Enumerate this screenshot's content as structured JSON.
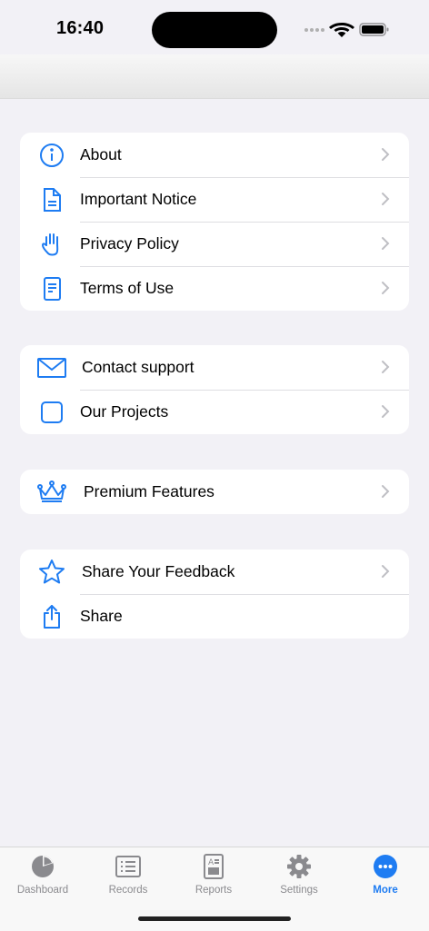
{
  "status": {
    "time": "16:40"
  },
  "accent": "#1e7cf2",
  "groups": [
    {
      "items": [
        {
          "label": "About",
          "icon": "info-icon",
          "chevron": true
        },
        {
          "label": "Important Notice",
          "icon": "document-icon",
          "chevron": true
        },
        {
          "label": "Privacy Policy",
          "icon": "hand-icon",
          "chevron": true
        },
        {
          "label": "Terms of Use",
          "icon": "doc-text-icon",
          "chevron": true
        }
      ]
    },
    {
      "items": [
        {
          "label": "Contact support",
          "icon": "envelope-icon",
          "chevron": true
        },
        {
          "label": "Our Projects",
          "icon": "square-icon",
          "chevron": true
        }
      ]
    },
    {
      "items": [
        {
          "label": "Premium Features",
          "icon": "crown-icon",
          "chevron": true
        }
      ]
    },
    {
      "items": [
        {
          "label": "Share Your Feedback",
          "icon": "star-icon",
          "chevron": true
        },
        {
          "label": "Share",
          "icon": "share-icon",
          "chevron": false
        }
      ]
    }
  ],
  "tabs": [
    {
      "label": "Dashboard",
      "icon": "pie-chart-icon"
    },
    {
      "label": "Records",
      "icon": "list-icon"
    },
    {
      "label": "Reports",
      "icon": "report-icon"
    },
    {
      "label": "Settings",
      "icon": "gear-icon"
    },
    {
      "label": "More",
      "icon": "more-icon",
      "active": true
    }
  ]
}
